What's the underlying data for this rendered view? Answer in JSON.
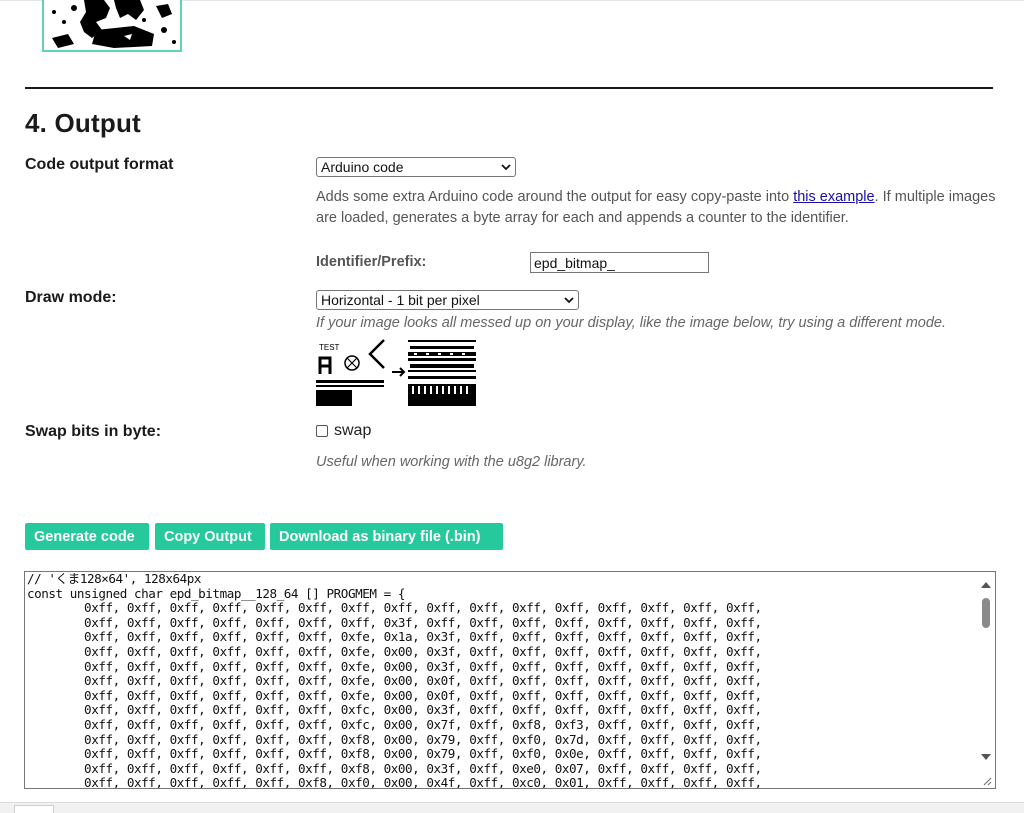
{
  "section": {
    "title": "4. Output"
  },
  "code_format": {
    "label": "Code output format",
    "selected": "Arduino code",
    "help_before": "Adds some extra Arduino code around the output for easy copy-paste into ",
    "help_link": "this example",
    "help_after": ". If multiple images are loaded, generates a byte array for each and appends a counter to the identifier."
  },
  "identifier": {
    "label": "Identifier/Prefix:",
    "value": "epd_bitmap_"
  },
  "draw_mode": {
    "label": "Draw mode:",
    "selected": "Horizontal - 1 bit per pixel",
    "help": "If your image looks all messed up on your display, like the image below, try using a different mode."
  },
  "swap_bits": {
    "label": "Swap bits in byte:",
    "checkbox_label": "swap",
    "checked": false,
    "help": "Useful when working with the u8g2 library."
  },
  "buttons": {
    "generate": "Generate code",
    "copy": "Copy Output",
    "download": "Download as binary file (.bin)"
  },
  "output": {
    "lines": [
      "// 'くま128×64', 128x64px",
      "const unsigned char epd_bitmap__128_64 [] PROGMEM = {",
      "        0xff, 0xff, 0xff, 0xff, 0xff, 0xff, 0xff, 0xff, 0xff, 0xff, 0xff, 0xff, 0xff, 0xff, 0xff, 0xff,",
      "        0xff, 0xff, 0xff, 0xff, 0xff, 0xff, 0xff, 0x3f, 0xff, 0xff, 0xff, 0xff, 0xff, 0xff, 0xff, 0xff,",
      "        0xff, 0xff, 0xff, 0xff, 0xff, 0xff, 0xfe, 0x1a, 0x3f, 0xff, 0xff, 0xff, 0xff, 0xff, 0xff, 0xff,",
      "        0xff, 0xff, 0xff, 0xff, 0xff, 0xff, 0xfe, 0x00, 0x3f, 0xff, 0xff, 0xff, 0xff, 0xff, 0xff, 0xff,",
      "        0xff, 0xff, 0xff, 0xff, 0xff, 0xff, 0xfe, 0x00, 0x3f, 0xff, 0xff, 0xff, 0xff, 0xff, 0xff, 0xff,",
      "        0xff, 0xff, 0xff, 0xff, 0xff, 0xff, 0xfe, 0x00, 0x0f, 0xff, 0xff, 0xff, 0xff, 0xff, 0xff, 0xff,",
      "        0xff, 0xff, 0xff, 0xff, 0xff, 0xff, 0xfe, 0x00, 0x0f, 0xff, 0xff, 0xff, 0xff, 0xff, 0xff, 0xff,",
      "        0xff, 0xff, 0xff, 0xff, 0xff, 0xff, 0xfc, 0x00, 0x3f, 0xff, 0xff, 0xff, 0xff, 0xff, 0xff, 0xff,",
      "        0xff, 0xff, 0xff, 0xff, 0xff, 0xff, 0xfc, 0x00, 0x7f, 0xff, 0xf8, 0xf3, 0xff, 0xff, 0xff, 0xff,",
      "        0xff, 0xff, 0xff, 0xff, 0xff, 0xff, 0xf8, 0x00, 0x79, 0xff, 0xf0, 0x7d, 0xff, 0xff, 0xff, 0xff,",
      "        0xff, 0xff, 0xff, 0xff, 0xff, 0xff, 0xf8, 0x00, 0x79, 0xff, 0xf0, 0x0e, 0xff, 0xff, 0xff, 0xff,",
      "        0xff, 0xff, 0xff, 0xff, 0xff, 0xff, 0xf8, 0x00, 0x3f, 0xff, 0xe0, 0x07, 0xff, 0xff, 0xff, 0xff,",
      "        0xff, 0xff, 0xff, 0xff, 0xff, 0xf8, 0xf0, 0x00, 0x4f, 0xff, 0xc0, 0x01, 0xff, 0xff, 0xff, 0xff,"
    ]
  },
  "drawmode_example": {
    "caption": "TEST"
  },
  "colors": {
    "accent": "#26c99b",
    "preview_border": "#5fd3b3",
    "link": "#1a0dab"
  },
  "icons": [
    "chevron-down-icon",
    "checkbox-icon",
    "scroll-up-icon",
    "scroll-down-icon",
    "resize-grip-icon"
  ]
}
